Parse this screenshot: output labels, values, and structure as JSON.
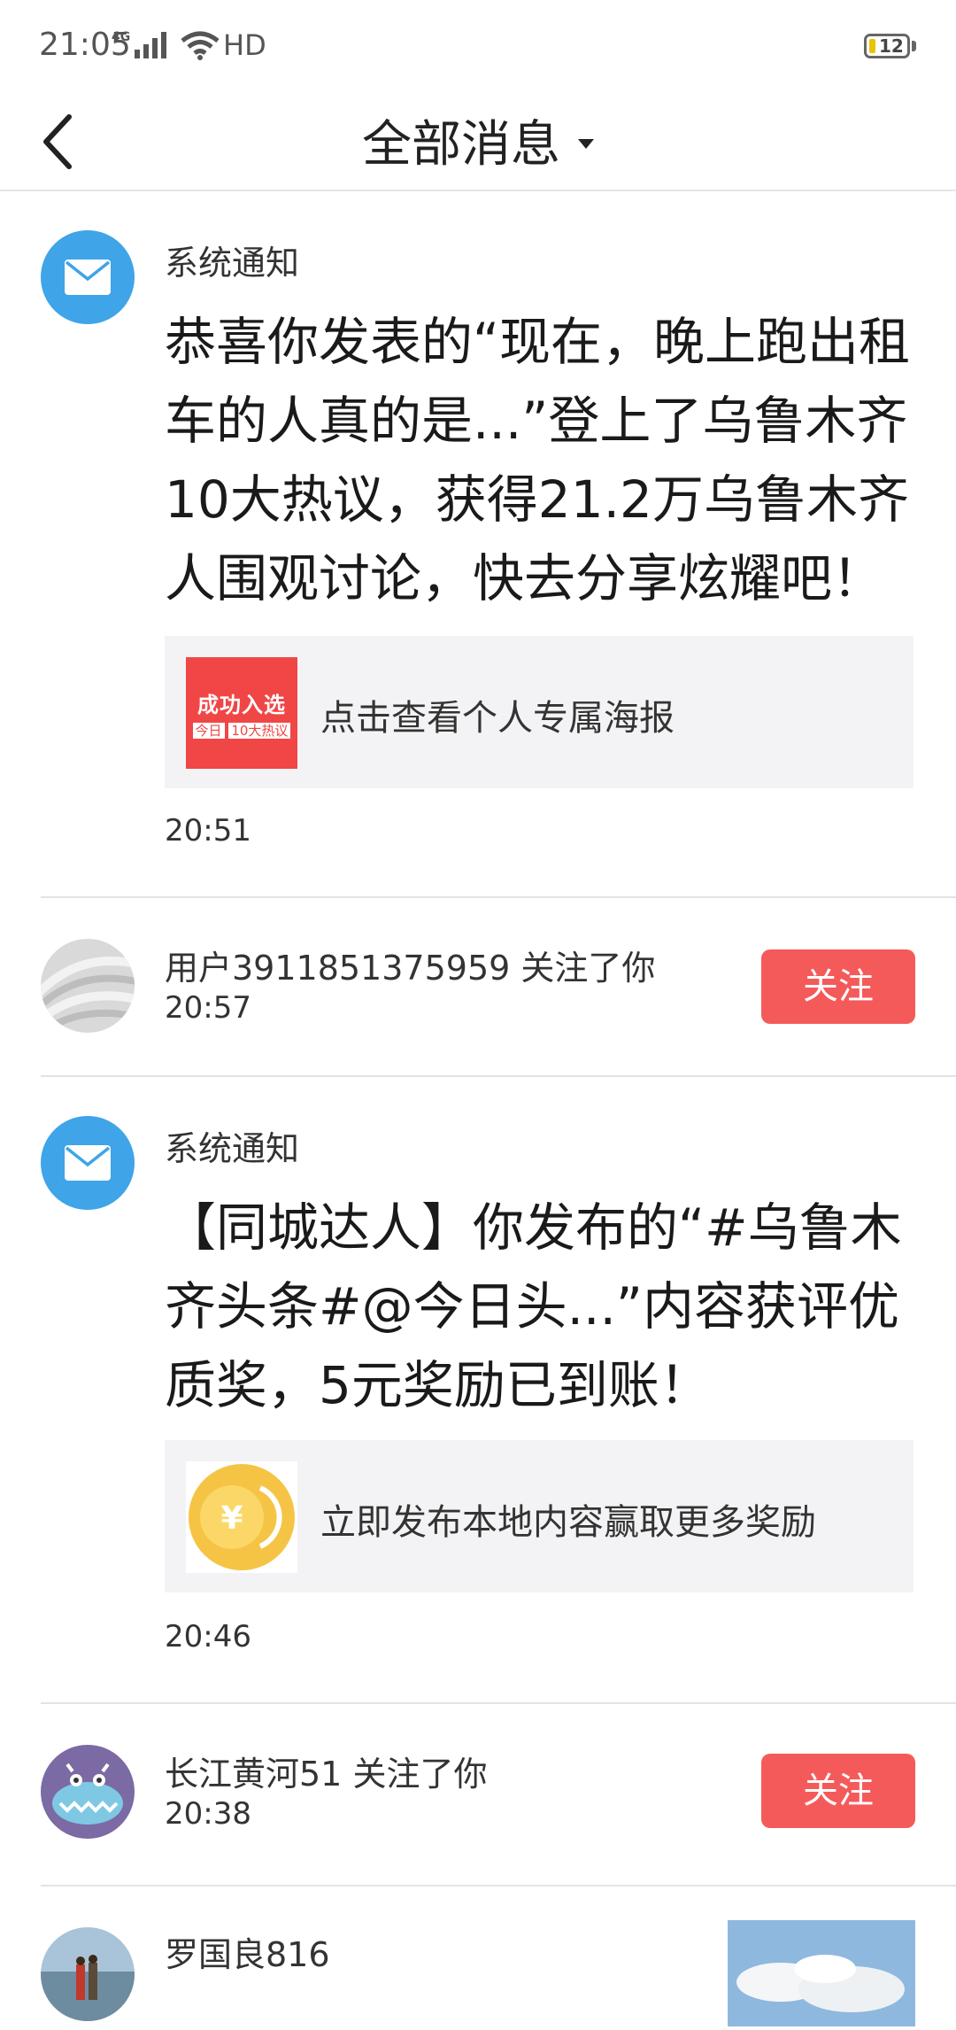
{
  "status_bar": {
    "time": "21:05",
    "network": "4G",
    "hd": "HD",
    "battery": "12"
  },
  "header": {
    "title": "全部消息"
  },
  "colors": {
    "accent": "#f55a5a",
    "mail_icon": "#3fa4e8",
    "coin": "#f6c445"
  },
  "messages": [
    {
      "type": "system",
      "label": "系统通知",
      "content": "恭喜你发表的“现在，晚上跑出租车的人真的是...”登上了乌鲁木齐10大热议，获得21.2万乌鲁木齐人围观讨论，快去分享炫耀吧！",
      "card_badge_big": "成功入选",
      "card_badge_small_1": "今日",
      "card_badge_small_2": "10大热议",
      "card_text": "点击查看个人专属海报",
      "time": "20:51"
    },
    {
      "type": "follow",
      "user": "用户3911851375959",
      "action": "关注了你",
      "time": "20:57",
      "button": "关注"
    },
    {
      "type": "system",
      "label": "系统通知",
      "content": "【同城达人】你发布的“#乌鲁木齐头条#@今日头...”内容获评优质奖，5元奖励已到账！",
      "card_icon_symbol": "¥",
      "card_text": "立即发布本地内容赢取更多奖励",
      "time": "20:46"
    },
    {
      "type": "follow",
      "user": "长江黄河51",
      "action": "关注了你",
      "time": "20:38",
      "button": "关注"
    },
    {
      "type": "comment",
      "user": "罗国良816"
    }
  ]
}
